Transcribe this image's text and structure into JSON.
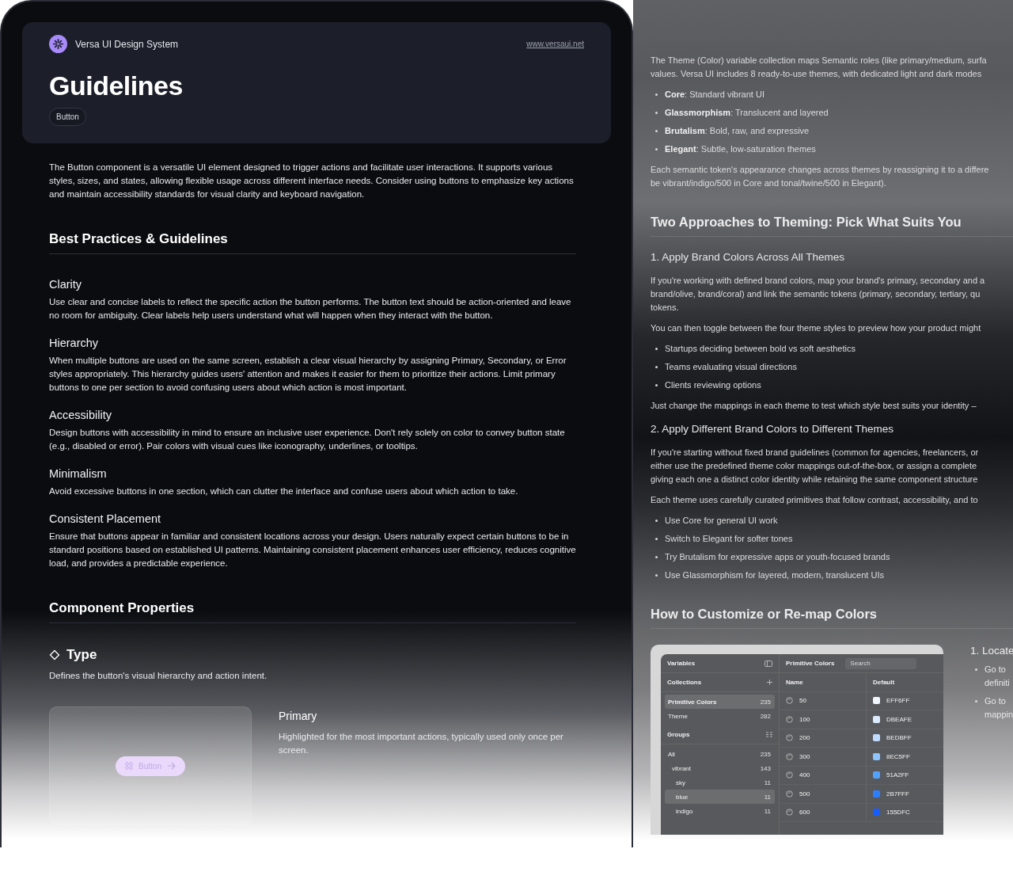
{
  "brand": {
    "name": "Versa UI Design System",
    "link": "www.versaui.net"
  },
  "page": {
    "title": "Guidelines",
    "tag": "Button"
  },
  "intro": "The Button component is a versatile UI element designed to trigger actions and facilitate user interactions. It supports various styles, sizes, and states, allowing flexible usage across different interface needs. Consider using buttons to emphasize key actions and maintain accessibility standards for visual clarity and keyboard navigation.",
  "best_practices": {
    "heading": "Best Practices & Guidelines",
    "items": [
      {
        "title": "Clarity",
        "text": "Use clear and concise labels to reflect the specific action the button performs. The button text should be action-oriented and leave no room for ambiguity. Clear labels help users understand what will happen when they interact with the button."
      },
      {
        "title": "Hierarchy",
        "text": "When multiple buttons are used on the same screen, establish a clear visual hierarchy by assigning Primary, Secondary, or Error styles appropriately. This hierarchy guides users' attention and makes it easier for them to prioritize their actions. Limit primary buttons to one per section to avoid confusing users about which action is most important."
      },
      {
        "title": "Accessibility",
        "text": "Design buttons with accessibility in mind to ensure an inclusive user experience. Don't rely solely on color to convey button state (e.g., disabled or error). Pair colors with visual cues like iconography, underlines, or tooltips."
      },
      {
        "title": "Minimalism",
        "text": "Avoid excessive buttons in one section, which can clutter the interface and confuse users about which action to take."
      },
      {
        "title": "Consistent Placement",
        "text": "Ensure that buttons appear in familiar and consistent locations across your design. Users naturally expect certain buttons to be in standard positions based on established UI patterns. Maintaining consistent placement enhances user efficiency, reduces cognitive load, and provides a predictable experience."
      }
    ]
  },
  "component_properties": {
    "heading": "Component Properties",
    "property": {
      "name": "Type",
      "description": "Defines the button's visual hierarchy and action intent.",
      "variant": {
        "button_label": "Button",
        "title": "Primary",
        "text": "Highlighted for the most important actions, typically used only once per screen."
      }
    }
  },
  "theming": {
    "blocks": [
      {
        "kind": "paragraph",
        "lines": [
          "The Theme (Color) variable collection maps Semantic roles (like primary/medium, surfa",
          "values. Versa UI includes 8 ready-to-use themes, with dedicated light and dark modes"
        ]
      },
      {
        "kind": "bullets",
        "items": [
          "**Core**: Standard vibrant UI",
          "**Glassmorphism**: Translucent and layered",
          "**Brutalism**: Bold, raw, and expressive",
          "**Elegant**: Subtle, low-saturation themes"
        ]
      },
      {
        "kind": "paragraph",
        "lines": [
          "Each semantic token's appearance changes across themes by reassigning it to a differe",
          "be vibrant/indigo/500 in Core and tonal/twine/500 in Elegant)."
        ]
      },
      {
        "kind": "h2",
        "text": "Two Approaches to Theming: Pick What Suits You"
      },
      {
        "kind": "h3",
        "text": "1. Apply Brand Colors Across All Themes"
      },
      {
        "kind": "paragraph",
        "lines": [
          "If you're working with defined brand colors, map your brand's primary, secondary and a",
          "brand/olive, brand/coral) and link the semantic tokens (primary, secondary, tertiary, qu",
          "tokens."
        ]
      },
      {
        "kind": "paragraph",
        "lines": [
          "You can then toggle between the four theme styles to preview how your product might"
        ]
      },
      {
        "kind": "bullets",
        "items": [
          "Startups deciding between bold vs soft aesthetics",
          "Teams evaluating visual directions",
          "Clients reviewing options"
        ]
      },
      {
        "kind": "paragraph",
        "lines": [
          "Just change the mappings in each theme to test which style best suits your identity –"
        ]
      },
      {
        "kind": "h3",
        "text": "2. Apply Different Brand Colors to Different Themes"
      },
      {
        "kind": "paragraph",
        "lines": [
          "If you're starting without fixed brand guidelines (common for agencies, freelancers, or",
          "either use the predefined theme color mappings out-of-the-box, or assign a complete",
          "giving each one a distinct color identity while retaining the same component structure"
        ]
      },
      {
        "kind": "paragraph",
        "lines": [
          "Each theme uses carefully curated primitives that follow contrast, accessibility, and to"
        ]
      },
      {
        "kind": "bullets",
        "items": [
          "Use Core for general UI work",
          "Switch to Elegant for softer tones",
          "Try Brutalism for expressive apps or youth-focused brands",
          "Use Glassmorphism for layered, modern, translucent UIs"
        ]
      },
      {
        "kind": "h2",
        "text": "How to Customize or Re-map Colors"
      }
    ],
    "variables_window": {
      "title": "Variables",
      "collections_label": "Collections",
      "collections": [
        {
          "name": "Primitive Colors",
          "count": "235",
          "selected": true
        },
        {
          "name": "Theme",
          "count": "282",
          "selected": false
        }
      ],
      "groups_label": "Groups",
      "groups": [
        {
          "name": "All",
          "count": "235",
          "selected": false,
          "children": [
            {
              "name": "vibrant",
              "count": "143",
              "selected": false,
              "children": [
                {
                  "name": "sky",
                  "count": "11",
                  "selected": false
                },
                {
                  "name": "blue",
                  "count": "11",
                  "selected": true
                },
                {
                  "name": "indigo",
                  "count": "11",
                  "selected": false
                }
              ]
            }
          ]
        }
      ],
      "table_title": "Primitive Colors",
      "search_placeholder": "Search",
      "columns": [
        "Name",
        "Default"
      ],
      "rows": [
        {
          "name": "50",
          "value": "EFF6FF",
          "color": "#eff6ff"
        },
        {
          "name": "100",
          "value": "DBEAFE",
          "color": "#dbeafe"
        },
        {
          "name": "200",
          "value": "BEDBFF",
          "color": "#bedbff"
        },
        {
          "name": "300",
          "value": "8EC5FF",
          "color": "#8ec5ff"
        },
        {
          "name": "400",
          "value": "51A2FF",
          "color": "#51a2ff"
        },
        {
          "name": "500",
          "value": "2B7FFF",
          "color": "#2b7fff"
        },
        {
          "name": "600",
          "value": "155DFC",
          "color": "#155dfc"
        }
      ]
    },
    "steps": {
      "title": "1. Locate",
      "items": [
        [
          "Go to",
          "definiti"
        ],
        [
          "Go to",
          "mappin"
        ]
      ]
    }
  }
}
